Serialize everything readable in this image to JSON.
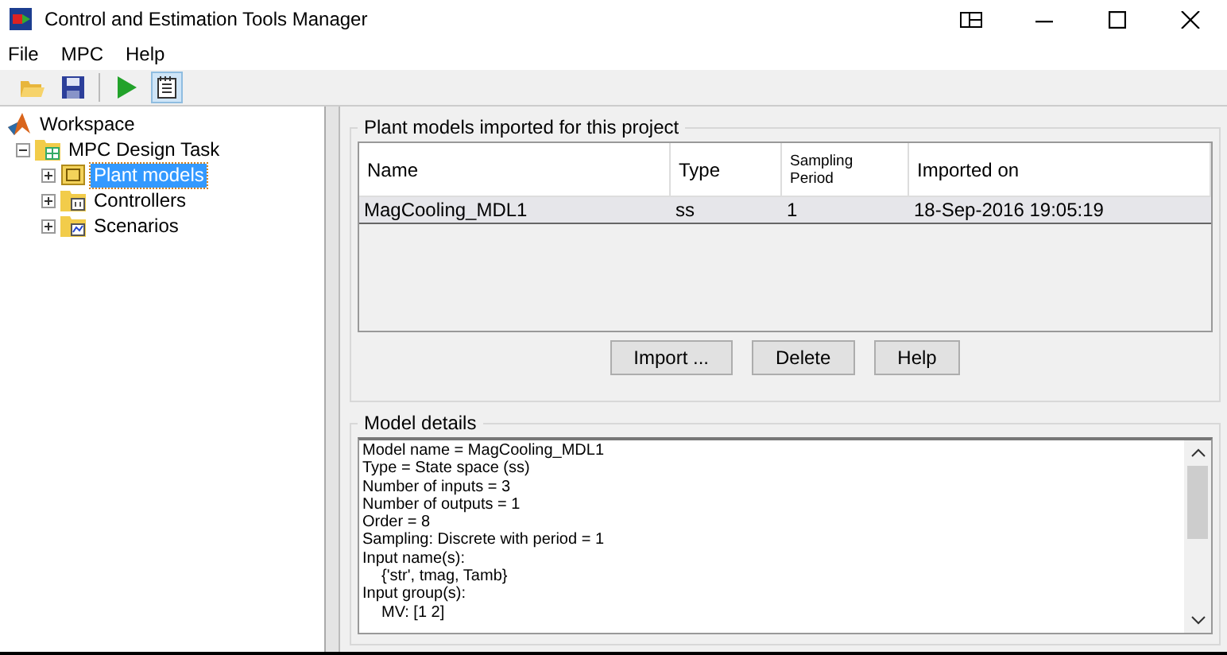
{
  "window": {
    "title": "Control and Estimation Tools Manager"
  },
  "menu": [
    "File",
    "MPC",
    "Help"
  ],
  "toolbar": [
    {
      "kind": "open",
      "pressed": false
    },
    {
      "kind": "save",
      "pressed": false
    },
    {
      "kind": "run",
      "pressed": false
    },
    {
      "kind": "notes",
      "pressed": true
    }
  ],
  "tree": {
    "label": "Workspace",
    "children": [
      {
        "label": "MPC Design Task",
        "expanded": true,
        "selected": false,
        "children": [
          {
            "label": "Plant models",
            "kind": "plant",
            "expanded": false,
            "selected": true
          },
          {
            "label": "Controllers",
            "kind": "controllers",
            "expanded": false,
            "selected": false
          },
          {
            "label": "Scenarios",
            "kind": "scenarios",
            "expanded": false,
            "selected": false
          }
        ]
      }
    ]
  },
  "plant_models": {
    "title": "Plant models imported for this project",
    "columns": [
      "Name",
      "Type",
      "Sampling Period",
      "Imported on"
    ],
    "rows": [
      {
        "selected": true,
        "cells": [
          "MagCooling_MDL1",
          "ss",
          "1",
          "18-Sep-2016 19:05:19"
        ]
      }
    ],
    "buttons": [
      "Import ...",
      "Delete",
      "Help"
    ]
  },
  "model_details": {
    "title": "Model details",
    "lines": [
      {
        "text": "Model name = MagCooling_MDL1",
        "indented": false
      },
      {
        "text": "Type = State space (ss)",
        "indented": false
      },
      {
        "text": "Number of inputs = 3",
        "indented": false
      },
      {
        "text": "Number of outputs = 1",
        "indented": false
      },
      {
        "text": "Order = 8",
        "indented": false
      },
      {
        "text": "Sampling: Discrete with period = 1",
        "indented": false
      },
      {
        "text": "Input name(s):",
        "indented": false
      },
      {
        "text": "{'str', tmag, Tamb}",
        "indented": true
      },
      {
        "text": "Input group(s):",
        "indented": false
      },
      {
        "text": "MV: [1 2]",
        "indented": true
      }
    ]
  }
}
